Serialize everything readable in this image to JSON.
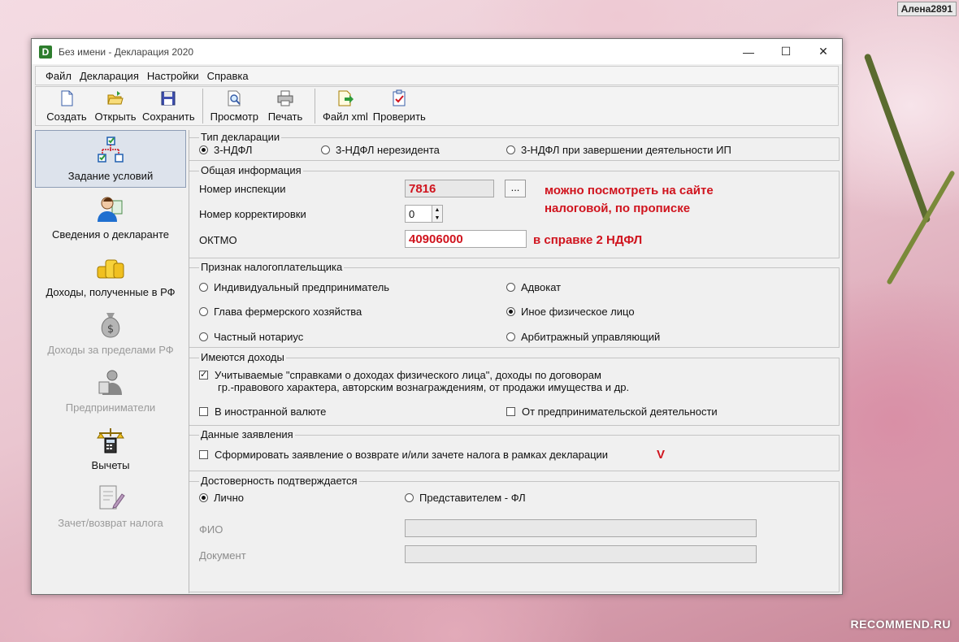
{
  "overlay": {
    "user_badge": "Алена2891",
    "watermark": "RECOMMEND.RU"
  },
  "window": {
    "title": "Без имени - Декларация 2020",
    "logo_letter": "D",
    "controls": {
      "minimize": "—",
      "maximize": "☐",
      "close": "✕"
    }
  },
  "menu": [
    "Файл",
    "Декларация",
    "Настройки",
    "Справка"
  ],
  "toolbar": {
    "create": "Создать",
    "open": "Открыть",
    "save": "Сохранить",
    "preview": "Просмотр",
    "print": "Печать",
    "xml": "Файл xml",
    "check": "Проверить"
  },
  "sidebar": [
    {
      "label": "Задание условий",
      "icon": "conditions-tree-icon",
      "active": true,
      "enabled": true
    },
    {
      "label": "Сведения о декларанте",
      "icon": "person-icon",
      "active": false,
      "enabled": true
    },
    {
      "label": "Доходы, полученные в РФ",
      "icon": "coins-icon",
      "active": false,
      "enabled": true
    },
    {
      "label": "Доходы за пределами РФ",
      "icon": "money-bag-icon",
      "active": false,
      "enabled": false
    },
    {
      "label": "Предприниматели",
      "icon": "entrepreneur-icon",
      "active": false,
      "enabled": false
    },
    {
      "label": "Вычеты",
      "icon": "scales-calculator-icon",
      "active": false,
      "enabled": true
    },
    {
      "label": "Зачет/возврат налога",
      "icon": "document-pen-icon",
      "active": false,
      "enabled": false
    }
  ],
  "decl_type": {
    "title": "Тип декларации",
    "options": [
      "3-НДФЛ",
      "3-НДФЛ нерезидента",
      "3-НДФЛ при завершении деятельности ИП"
    ],
    "selected": "3-НДФЛ"
  },
  "general": {
    "title": "Общая информация",
    "inspection_label": "Номер инспекции",
    "inspection_value": "7816",
    "browse_label": "...",
    "correction_label": "Номер корректировки",
    "correction_value": "0",
    "oktmo_label": "ОКТМО",
    "oktmo_value": "40906000",
    "note_inspection_1": "можно посмотреть на сайте",
    "note_inspection_2": "налоговой, по прописке",
    "note_oktmo": "в справке 2 НДФЛ"
  },
  "taxpayer": {
    "title": "Признак налогоплательщика",
    "options": [
      "Индивидуальный предприниматель",
      "Адвокат",
      "Глава фермерского хозяйства",
      "Иное физическое лицо",
      "Частный нотариус",
      "Арбитражный управляющий"
    ],
    "selected": "Иное физическое лицо"
  },
  "income": {
    "title": "Имеются доходы",
    "item1_line1": "Учитываемые \"справками о доходах физического лица\", доходы по договорам",
    "item1_line2": "гр.-правового характера, авторским вознаграждениям, от продажи имущества и др.",
    "item1_checked": true,
    "item2": "В иностранной валюте",
    "item2_checked": false,
    "item3": "От предпринимательской деятельности",
    "item3_checked": false
  },
  "application": {
    "title": "Данные заявления",
    "item": "Сформировать заявление о  возврате и/или зачете налога в рамках декларации",
    "checked": false,
    "mark": "V"
  },
  "confirm": {
    "title": "Достоверность подтверждается",
    "opt1": "Лично",
    "opt2": "Представителем - ФЛ",
    "selected": "Лично",
    "fio_label": "ФИО",
    "doc_label": "Документ",
    "fio_value": "",
    "doc_value": ""
  }
}
